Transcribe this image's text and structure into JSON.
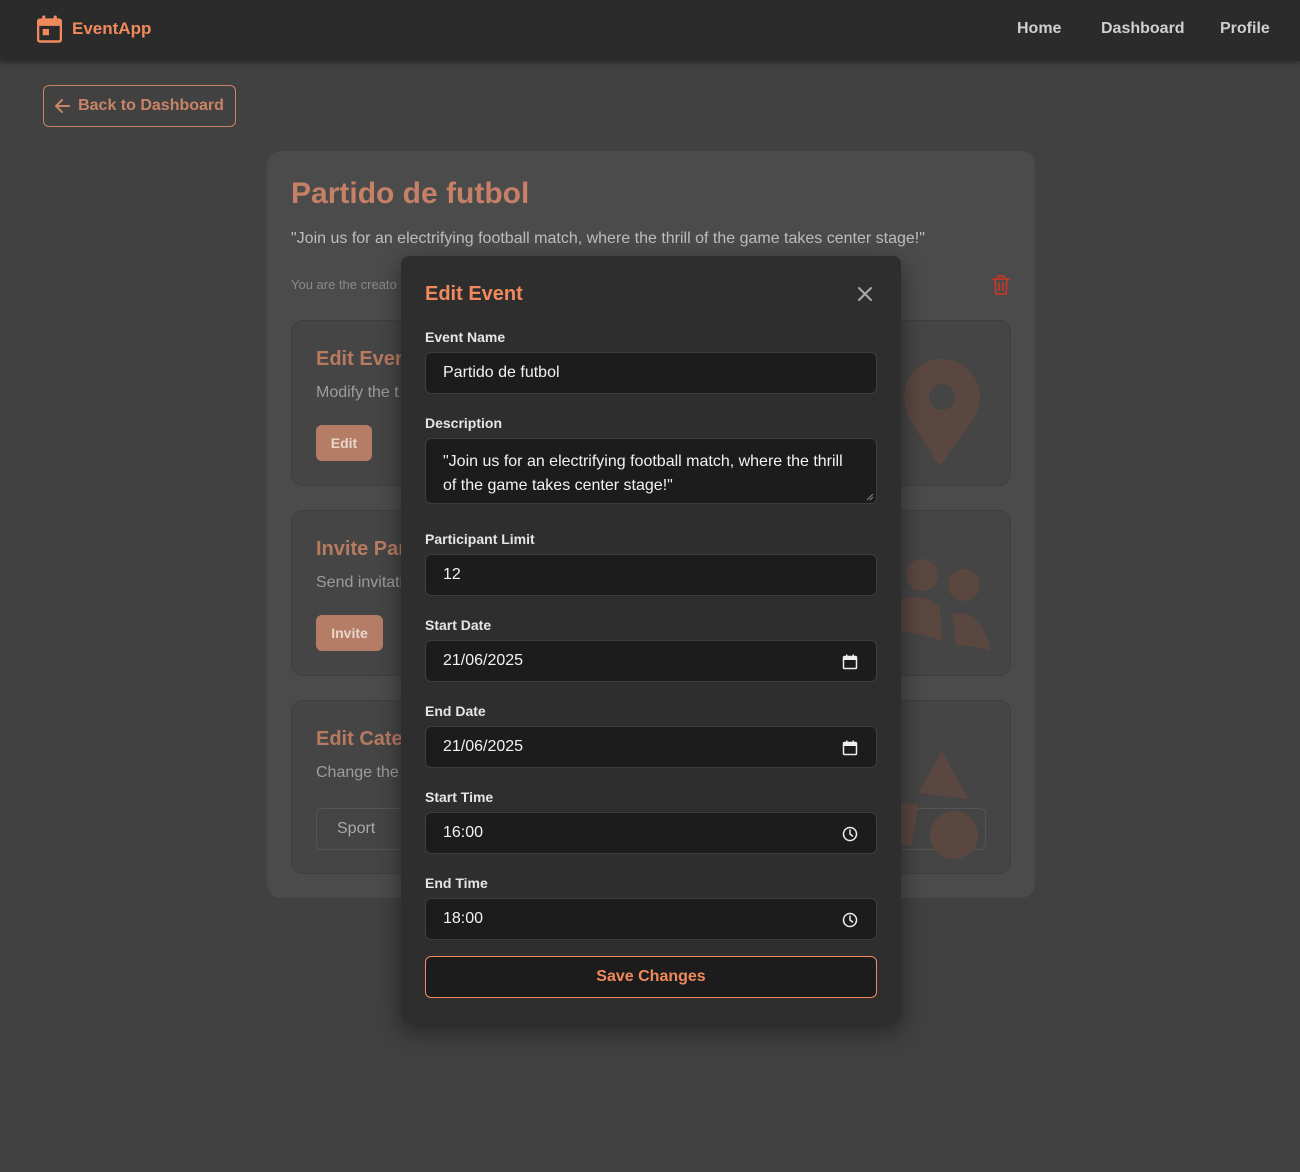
{
  "brand": {
    "name": "EventApp",
    "icon": "calendar-icon",
    "accent": "#f08a5c"
  },
  "nav": {
    "home": "Home",
    "dashboard": "Dashboard",
    "profile": "Profile"
  },
  "back_button": {
    "label": "Back to Dashboard",
    "icon": "arrow-left-icon"
  },
  "event": {
    "title": "Partido de futbol",
    "description": "\"Join us for an electrifying football match, where the thrill of the game takes center stage!\"",
    "creator_note": "You are the creato"
  },
  "actions": [
    {
      "title": "Edit Even",
      "subtitle": "Modify the t",
      "button": "Edit"
    },
    {
      "title": "Invite Par",
      "subtitle": "Send invitati",
      "button": "Invite"
    },
    {
      "title": "Edit Cate",
      "subtitle": "Change the",
      "select_value": "Sport"
    }
  ],
  "modal": {
    "title": "Edit Event",
    "fields": {
      "event_name": {
        "label": "Event Name",
        "value": "Partido de futbol"
      },
      "description": {
        "label": "Description",
        "value": "\"Join us for an electrifying football match, where the thrill of the game takes center stage!\""
      },
      "participant_limit": {
        "label": "Participant Limit",
        "value": "12"
      },
      "start_date": {
        "label": "Start Date",
        "value": "21/06/2025"
      },
      "end_date": {
        "label": "End Date",
        "value": "21/06/2025"
      },
      "start_time": {
        "label": "Start Time",
        "value": "16:00"
      },
      "end_time": {
        "label": "End Time",
        "value": "18:00"
      }
    },
    "save_label": "Save Changes"
  }
}
